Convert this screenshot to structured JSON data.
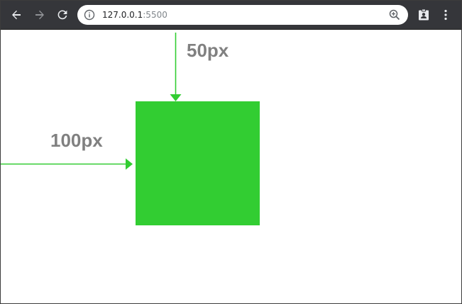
{
  "browser": {
    "url_host": "127.0.0.1",
    "url_port": ":5500",
    "icons": {
      "back": "arrow-left-icon",
      "forward": "arrow-right-icon",
      "reload": "reload-icon",
      "info": "info-icon",
      "zoom": "zoom-in-icon",
      "profile": "contact-card-icon",
      "menu": "more-vert-icon"
    }
  },
  "demo": {
    "top_offset_label": "50px",
    "left_offset_label": "100px",
    "box_color": "#32cd32",
    "arrow_color": "#32cd32",
    "label_color": "#808080"
  }
}
